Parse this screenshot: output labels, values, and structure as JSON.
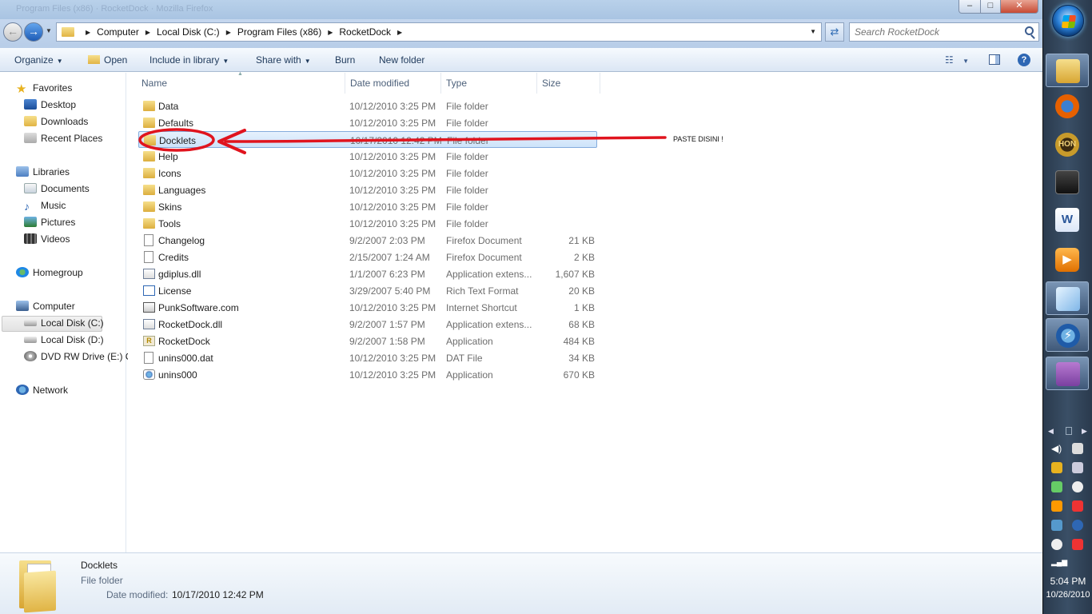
{
  "window": {
    "title_ghost": "Program Files (x86)  ·  RocketDock  ·  Mozilla Firefox",
    "controls": {
      "minimize": "–",
      "maximize": "□",
      "close": "✕"
    }
  },
  "address": {
    "crumbs": [
      "Computer",
      "Local Disk (C:)",
      "Program Files (x86)",
      "RocketDock"
    ],
    "search_placeholder": "Search RocketDock"
  },
  "toolbar": {
    "organize": "Organize",
    "open": "Open",
    "include_in_library": "Include in library",
    "share_with": "Share with",
    "burn": "Burn",
    "new_folder": "New folder",
    "help": "?"
  },
  "nav": {
    "favorites": "Favorites",
    "desktop": "Desktop",
    "downloads": "Downloads",
    "recent_places": "Recent Places",
    "libraries": "Libraries",
    "documents": "Documents",
    "music": "Music",
    "pictures": "Pictures",
    "videos": "Videos",
    "homegroup": "Homegroup",
    "computer": "Computer",
    "local_c": "Local Disk (C:)",
    "local_d": "Local Disk (D:)",
    "dvd": "DVD RW Drive (E:) C",
    "network": "Network"
  },
  "columns": {
    "name": "Name",
    "date": "Date modified",
    "type": "Type",
    "size": "Size"
  },
  "files": [
    {
      "name": "Data",
      "date": "10/12/2010 3:25 PM",
      "type": "File folder",
      "size": "",
      "icon": "folder-icon"
    },
    {
      "name": "Defaults",
      "date": "10/12/2010 3:25 PM",
      "type": "File folder",
      "size": "",
      "icon": "folder-icon"
    },
    {
      "name": "Docklets",
      "date": "10/17/2010 12:42 PM",
      "type": "File folder",
      "size": "",
      "icon": "folder-icon"
    },
    {
      "name": "Help",
      "date": "10/12/2010 3:25 PM",
      "type": "File folder",
      "size": "",
      "icon": "folder-icon"
    },
    {
      "name": "Icons",
      "date": "10/12/2010 3:25 PM",
      "type": "File folder",
      "size": "",
      "icon": "folder-icon"
    },
    {
      "name": "Languages",
      "date": "10/12/2010 3:25 PM",
      "type": "File folder",
      "size": "",
      "icon": "folder-icon"
    },
    {
      "name": "Skins",
      "date": "10/12/2010 3:25 PM",
      "type": "File folder",
      "size": "",
      "icon": "folder-icon"
    },
    {
      "name": "Tools",
      "date": "10/12/2010 3:25 PM",
      "type": "File folder",
      "size": "",
      "icon": "folder-icon"
    },
    {
      "name": "Changelog",
      "date": "9/2/2007 2:03 PM",
      "type": "Firefox Document",
      "size": "21 KB",
      "icon": "document-icon"
    },
    {
      "name": "Credits",
      "date": "2/15/2007 1:24 AM",
      "type": "Firefox Document",
      "size": "2 KB",
      "icon": "document-icon"
    },
    {
      "name": "gdiplus.dll",
      "date": "1/1/2007 6:23 PM",
      "type": "Application extens...",
      "size": "1,607 KB",
      "icon": "dll-icon"
    },
    {
      "name": "License",
      "date": "3/29/2007 5:40 PM",
      "type": "Rich Text Format",
      "size": "20 KB",
      "icon": "rtf-icon"
    },
    {
      "name": "PunkSoftware.com",
      "date": "10/12/2010 3:25 PM",
      "type": "Internet Shortcut",
      "size": "1 KB",
      "icon": "shortcut-icon"
    },
    {
      "name": "RocketDock.dll",
      "date": "9/2/2007 1:57 PM",
      "type": "Application extens...",
      "size": "68 KB",
      "icon": "dll-icon"
    },
    {
      "name": "RocketDock",
      "date": "9/2/2007 1:58 PM",
      "type": "Application",
      "size": "484 KB",
      "icon": "rocketdock-icon"
    },
    {
      "name": "unins000.dat",
      "date": "10/12/2010 3:25 PM",
      "type": "DAT File",
      "size": "34 KB",
      "icon": "document-icon"
    },
    {
      "name": "unins000",
      "date": "10/12/2010 3:25 PM",
      "type": "Application",
      "size": "670 KB",
      "icon": "uninstaller-icon"
    }
  ],
  "selected_file": "Docklets",
  "annotation": {
    "text": "PASTE DISINI !",
    "color": "#e0141e"
  },
  "details": {
    "name": "Docklets",
    "type": "File folder",
    "modified_label": "Date modified:",
    "modified_value": "10/17/2010 12:42 PM"
  },
  "taskbar": {
    "apps": [
      "folder-icon",
      "firefox-icon",
      "hon-icon",
      "game-icon",
      "word-icon",
      "media-player-icon",
      "notes-icon",
      "daemon-tools-icon",
      "winrar-icon"
    ],
    "hon_label": "HON",
    "word_label": "W",
    "media_label": "▶",
    "daemon_label": "⚡",
    "clock_time": "5:04 PM",
    "clock_date": "10/26/2010"
  }
}
